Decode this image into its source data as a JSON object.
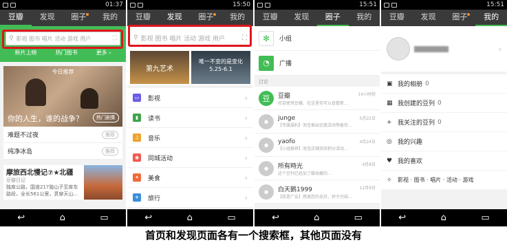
{
  "p1": {
    "time": "01:37",
    "tabs": [
      "豆瓣",
      "发现",
      "圈子",
      "我的"
    ],
    "search_ph": "影视 图书 唱片 活动 游戏 用户",
    "quick": [
      "新片上映",
      "热门图书",
      "更多"
    ],
    "rec_label": "今日推荐",
    "rec_title": "你的人生，谁的战争？",
    "rec_btn": "热门剧集",
    "list": [
      {
        "t": "难题不过夜",
        "b": "推荐"
      },
      {
        "t": "纯净冰岛",
        "b": "推荐"
      }
    ],
    "diary": {
      "title": "摩旅西北慢记⑦★北疆",
      "sub": "豆瓣日记",
      "body": "独库公路，国道217独山子至库车路段，全长561公里，贯穿天山..."
    }
  },
  "p2": {
    "time": "15:50",
    "tabs": [
      "豆瓣",
      "发现",
      "圈子",
      "我的"
    ],
    "search_ph": "影视 图书 唱片 活动 游戏 用户",
    "banners": [
      "第九艺术",
      "唯一不变的是变化",
      "5.25-6.1"
    ],
    "cats": [
      {
        "n": "影视",
        "c": "#6b5ce8",
        "g": "▭"
      },
      {
        "n": "读书",
        "c": "#3ea14b",
        "g": "▮"
      },
      {
        "n": "音乐",
        "c": "#f0a22b",
        "g": "♫"
      },
      {
        "n": "同城活动",
        "c": "#f25a4d",
        "g": "◉"
      },
      {
        "n": "美食",
        "c": "#f06a3a",
        "g": "✦"
      },
      {
        "n": "旅行",
        "c": "#3d8ddb",
        "g": "✈"
      }
    ]
  },
  "p3": {
    "time": "15:51",
    "tabs": [
      "豆瓣",
      "发现",
      "圈子",
      "我的"
    ],
    "groups": [
      {
        "n": "小组",
        "c": "#42bd56"
      },
      {
        "n": "广播",
        "c": "#42bd56"
      }
    ],
    "section": "讨论",
    "msgs": [
      {
        "n": "豆瓣",
        "m": "欢迎使用豆瓣。在这里你可以查看新...",
        "d": "14小时前"
      },
      {
        "n": "junge",
        "m": "【专属福利】淘宝推出优惠活动等着你...",
        "d": "5月22日"
      },
      {
        "n": "yaofo",
        "m": "【小组推荐】淘宝店铺双倍积分活动...",
        "d": "4月24日"
      },
      {
        "n": "所有時光",
        "m": "这个豆列已经加了碟收藏的...",
        "d": "4月8日"
      },
      {
        "n": "白天鹅1999",
        "m": "【我是广告】感谢您的支持，终于完结...",
        "d": "12月9日"
      }
    ]
  },
  "p4": {
    "time": "15:51",
    "tabs": [
      "豆瓣",
      "发现",
      "圈子",
      "我的"
    ],
    "items": [
      {
        "t": "我的相册",
        "n": "0",
        "g": "▣"
      },
      {
        "t": "我创建的豆列",
        "n": "0",
        "g": "▦"
      },
      {
        "t": "我关注的豆列",
        "n": "0",
        "g": "+"
      },
      {
        "t": "我的兴趣",
        "n": "",
        "g": "◎"
      },
      {
        "t": "我的喜欢",
        "n": "",
        "g": "♥"
      },
      {
        "t": "影视 · 图书 · 唱片 · 活动 · 游戏",
        "n": "",
        "g": "✧"
      }
    ]
  },
  "caption": "首页和发现页面各有一个搜索框，其他页面没有",
  "colors": {
    "green": "#42bd56",
    "red": "#e0141c",
    "tabbar": "#3a3a3a"
  }
}
